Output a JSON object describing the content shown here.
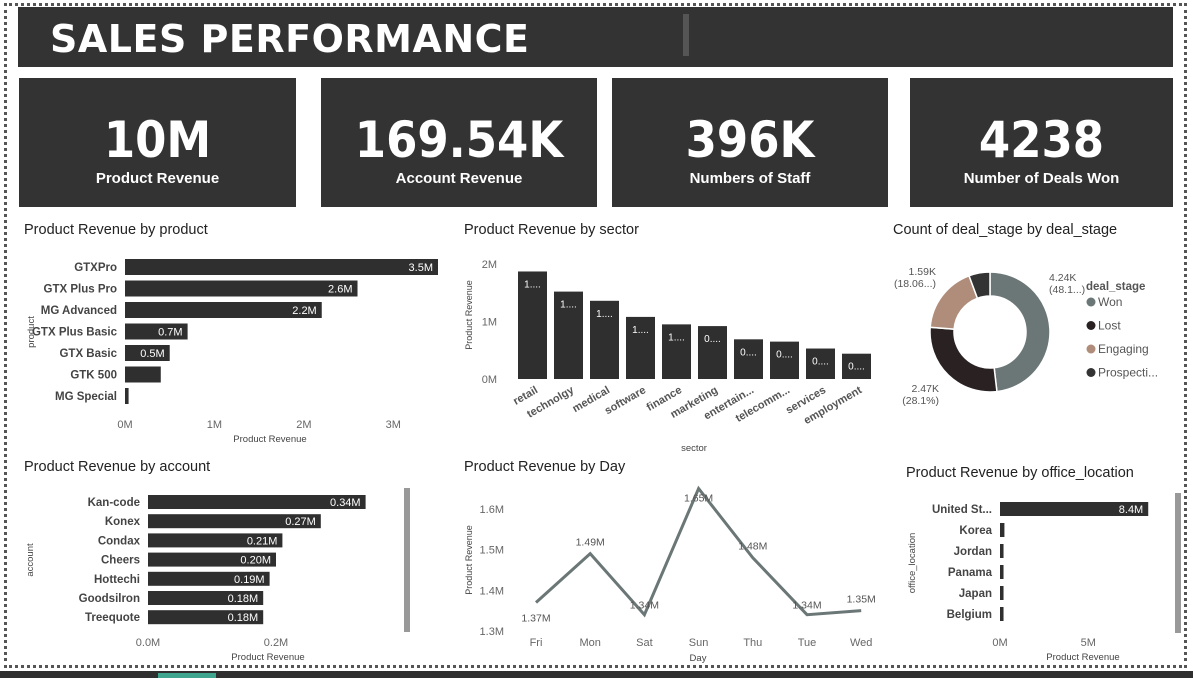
{
  "header": {
    "title": "SALES PERFORMANCE"
  },
  "kpis": [
    {
      "value": "10M",
      "label": "Product Revenue"
    },
    {
      "value": "169.54K",
      "label": "Account Revenue"
    },
    {
      "value": "396K",
      "label": "Numbers of Staff"
    },
    {
      "value": "4238",
      "label": "Number of Deals Won"
    }
  ],
  "colors": {
    "bar": "#2f2f2f",
    "kpi_bg": "#333333",
    "line": "#6b7676",
    "won": "#6b7676",
    "lost": "#2a2222",
    "engaging": "#b08d7a",
    "prospecting": "#333333"
  },
  "chart_data": [
    {
      "type": "bar",
      "orientation": "horizontal",
      "title": "Product Revenue by product",
      "xlabel": "Product Revenue",
      "ylabel": "product",
      "categories": [
        "GTXPro",
        "GTX Plus Pro",
        "MG Advanced",
        "GTX Plus Basic",
        "GTX Basic",
        "GTK 500",
        "MG Special"
      ],
      "values": [
        3.5,
        2.6,
        2.2,
        0.7,
        0.5,
        0.4,
        0.04
      ],
      "data_labels": [
        "3.5M",
        "2.6M",
        "2.2M",
        "0.7M",
        "0.5M",
        "",
        ""
      ],
      "ticks": [
        "0M",
        "1M",
        "2M",
        "3M"
      ],
      "xlim": [
        0,
        3.5
      ]
    },
    {
      "type": "bar",
      "title": "Product Revenue by sector",
      "xlabel": "sector",
      "ylabel": "Product Revenue",
      "categories": [
        "retail",
        "technolgy",
        "medical",
        "software",
        "finance",
        "marketing",
        "entertain...",
        "telecomm...",
        "services",
        "employment"
      ],
      "values": [
        1.87,
        1.52,
        1.36,
        1.08,
        0.95,
        0.92,
        0.69,
        0.65,
        0.53,
        0.44
      ],
      "data_labels": [
        "1....",
        "1....",
        "1....",
        "1....",
        "1....",
        "0....",
        "0....",
        "0....",
        "0....",
        "0...."
      ],
      "ticks": [
        "0M",
        "1M",
        "2M"
      ],
      "ylim": [
        0,
        2
      ]
    },
    {
      "type": "pie",
      "donut": true,
      "title": "Count of deal_stage by deal_stage",
      "legend_title": "deal_stage",
      "categories": [
        "Won",
        "Lost",
        "Engaging",
        "Prospecti..."
      ],
      "values": [
        4238,
        2473,
        1589,
        500
      ],
      "data_labels": [
        "4.24K\n(48.1...)",
        "2.47K\n(28.1%)",
        "1.59K\n(18.06...)",
        ""
      ]
    },
    {
      "type": "bar",
      "orientation": "horizontal",
      "title": "Product Revenue by account",
      "xlabel": "Product Revenue",
      "ylabel": "account",
      "categories": [
        "Kan-code",
        "Konex",
        "Condax",
        "Cheers",
        "Hottechi",
        "Goodsilron",
        "Treequote"
      ],
      "values": [
        0.34,
        0.27,
        0.21,
        0.2,
        0.19,
        0.18,
        0.18
      ],
      "data_labels": [
        "0.34M",
        "0.27M",
        "0.21M",
        "0.20M",
        "0.19M",
        "0.18M",
        "0.18M"
      ],
      "ticks": [
        "0.0M",
        "0.2M"
      ],
      "xlim": [
        0,
        0.35
      ]
    },
    {
      "type": "line",
      "title": "Product Revenue by Day",
      "xlabel": "Day",
      "ylabel": "Product Revenue",
      "categories": [
        "Fri",
        "Mon",
        "Sat",
        "Sun",
        "Thu",
        "Tue",
        "Wed"
      ],
      "values": [
        1.37,
        1.49,
        1.34,
        1.65,
        1.48,
        1.34,
        1.35
      ],
      "data_labels": [
        "1.37M",
        "1.49M",
        "1.34M",
        "1.65M",
        "1.48M",
        "1.34M",
        "1.35M"
      ],
      "ticks": [
        "1.3M",
        "1.4M",
        "1.5M",
        "1.6M"
      ],
      "ylim": [
        1.3,
        1.65
      ]
    },
    {
      "type": "bar",
      "orientation": "horizontal",
      "title": "Product Revenue by office_location",
      "xlabel": "Product Revenue",
      "ylabel": "office_location",
      "categories": [
        "United St...",
        "Korea",
        "Jordan",
        "Panama",
        "Japan",
        "Belgium"
      ],
      "values": [
        8.4,
        0.25,
        0.2,
        0.2,
        0.2,
        0.2
      ],
      "data_labels": [
        "8.4M",
        "",
        "",
        "",
        "",
        ""
      ],
      "ticks": [
        "0M",
        "5M"
      ],
      "xlim": [
        0,
        8.5
      ]
    }
  ]
}
